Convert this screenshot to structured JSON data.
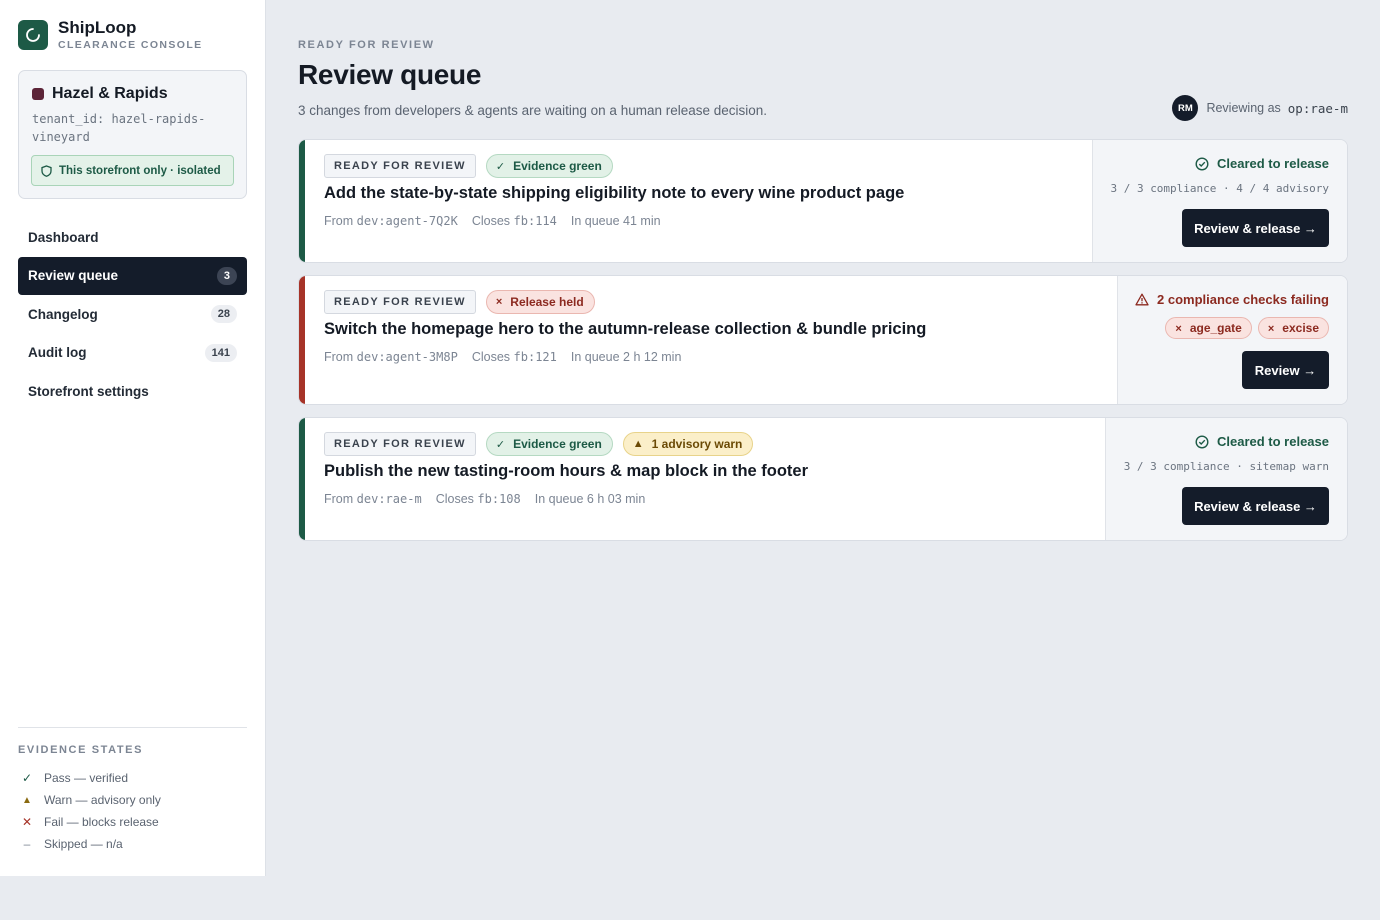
{
  "brand": {
    "name": "ShipLoop",
    "sub": "CLEARANCE CONSOLE"
  },
  "tenant": {
    "name": "Hazel & Rapids",
    "id": "tenant_id: hazel-rapids-vineyard",
    "isolation": "This storefront only · isolated"
  },
  "nav": [
    {
      "label": "Dashboard",
      "count": ""
    },
    {
      "label": "Review queue",
      "count": "3"
    },
    {
      "label": "Changelog",
      "count": "28"
    },
    {
      "label": "Audit log",
      "count": "141"
    },
    {
      "label": "Storefront settings",
      "count": ""
    }
  ],
  "legend": {
    "title": "EVIDENCE STATES",
    "items": [
      {
        "glyph": "✓",
        "label": "Pass — verified",
        "color": "#1d5a46"
      },
      {
        "glyph": "▲",
        "label": "Warn — advisory only",
        "color": "#8a6a10"
      },
      {
        "glyph": "✕",
        "label": "Fail — blocks release",
        "color": "#a63328"
      },
      {
        "glyph": "–",
        "label": "Skipped — n/a",
        "color": "#7c8593"
      }
    ]
  },
  "header": {
    "eyebrow": "READY FOR REVIEW",
    "title": "Review queue",
    "subtitle": "3 changes from developers & agents are waiting on a human release decision.",
    "reviewer_initials": "RM",
    "reviewer_label": "Reviewing as",
    "reviewer_id": "op:rae-m"
  },
  "cards": [
    {
      "status_tag": "READY FOR REVIEW",
      "pills": [
        {
          "glyph": "✓",
          "label": "Evidence green"
        }
      ],
      "title": "Add the state-by-state shipping eligibility note to every wine product page",
      "from_label": "From",
      "from_value": "dev:agent-7Q2K",
      "closes_label": "Closes",
      "closes_value": "fb:114",
      "queue_label": "In queue",
      "queue_value": "41 min",
      "side_status": "Cleared to release",
      "side_detail": "3 / 3 compliance · 4 / 4 advisory",
      "button": "Review & release →"
    },
    {
      "status_tag": "READY FOR REVIEW",
      "pills": [
        {
          "glyph": "×",
          "label": "Release held"
        }
      ],
      "title": "Switch the homepage hero to the autumn-release collection & bundle pricing",
      "from_label": "From",
      "from_value": "dev:agent-3M8P",
      "closes_label": "Closes",
      "closes_value": "fb:121",
      "queue_label": "In queue",
      "queue_value": "2 h 12 min",
      "side_status": "2 compliance checks failing",
      "chips": [
        {
          "glyph": "×",
          "label": "age_gate"
        },
        {
          "glyph": "×",
          "label": "excise"
        }
      ],
      "button": "Review →"
    },
    {
      "status_tag": "READY FOR REVIEW",
      "pills": [
        {
          "glyph": "✓",
          "label": "Evidence green"
        },
        {
          "glyph": "▲",
          "label": "1 advisory warn"
        }
      ],
      "title": "Publish the new tasting-room hours & map block in the footer",
      "from_label": "From",
      "from_value": "dev:rae-m",
      "closes_label": "Closes",
      "closes_value": "fb:108",
      "queue_label": "In queue",
      "queue_value": "6 h 03 min",
      "side_status": "Cleared to release",
      "side_detail": "3 / 3 compliance · sitemap warn",
      "button": "Review & release →"
    }
  ]
}
